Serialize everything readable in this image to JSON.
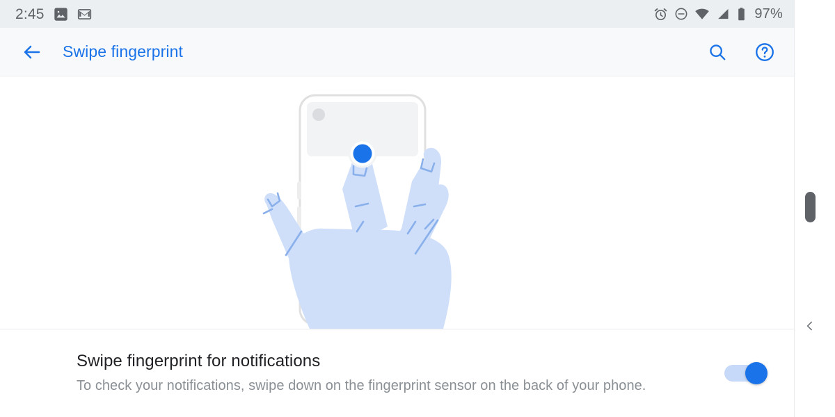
{
  "status_bar": {
    "clock": "2:45",
    "battery_percent": "97%",
    "left_icons": [
      "photos-icon",
      "gmail-icon"
    ],
    "right_icons": [
      "alarm-icon",
      "do-not-disturb-icon",
      "wifi-icon",
      "cell-signal-icon",
      "battery-icon"
    ],
    "background_color": "#eceff1",
    "text_color": "#5f6368"
  },
  "app_bar": {
    "back_label": "back-arrow",
    "title": "Swipe fingerprint",
    "search_label": "search-icon",
    "help_label": "help-icon",
    "accent_color": "#1a73e8",
    "background_color": "#f8f9fa"
  },
  "illustration": {
    "name": "swipe-fingerprint-illustration",
    "description": "Hand holding phone with index finger on rear fingerprint sensor",
    "phone_outline_color": "#e0e0e0",
    "phone_glass_color": "#f1f3f4",
    "camera_color": "#dadce0",
    "sensor_color": "#1a73e8",
    "hand_fill_color": "#cfdffa",
    "hand_line_color": "#8ab0ec"
  },
  "setting": {
    "title": "Swipe fingerprint for notifications",
    "subtitle": "To check your notifications, swipe down on the fingerprint sensor on the back of your phone.",
    "toggle": {
      "name": "swipe-fingerprint-toggle",
      "state": "on",
      "on_color": "#1a73e8",
      "track_color": "#c7d9f8"
    }
  },
  "system_chrome": {
    "scrollbar_handle": "scrollbar-handle",
    "back_gesture_chevron": "‹"
  }
}
